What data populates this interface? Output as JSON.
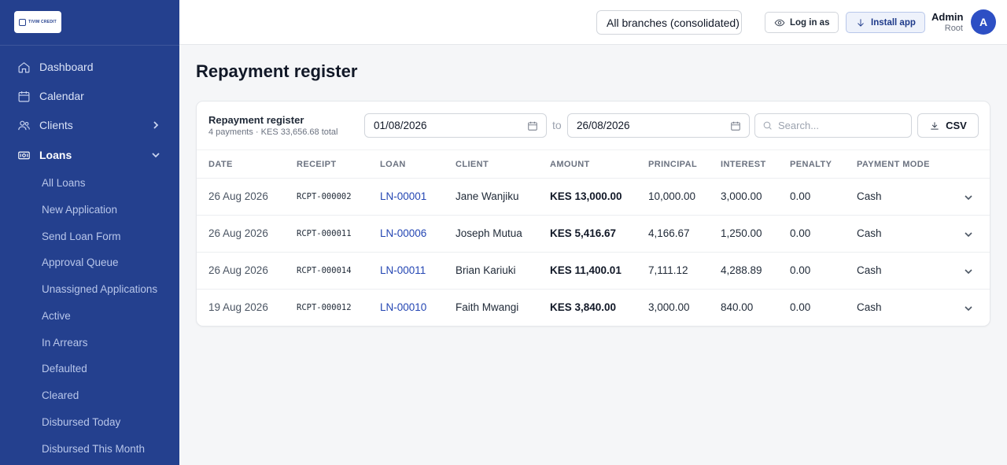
{
  "app": {
    "logo_text": "TIVIM CREDIT"
  },
  "sidebar": {
    "items": [
      {
        "label": "Dashboard",
        "icon": "home-icon"
      },
      {
        "label": "Calendar",
        "icon": "calendar-icon"
      },
      {
        "label": "Clients",
        "icon": "users-icon"
      },
      {
        "label": "Loans",
        "icon": "loans-icon"
      }
    ],
    "loans_sub": [
      "All Loans",
      "New Application",
      "Send Loan Form",
      "Approval Queue",
      "Unassigned Applications",
      "Active",
      "In Arrears",
      "Defaulted",
      "Cleared",
      "Disbursed Today",
      "Disbursed This Month"
    ]
  },
  "topbar": {
    "branch": "All branches (consolidated)",
    "login_as": "Log in as",
    "install": "Install app",
    "user_name": "Admin",
    "user_role": "Root",
    "avatar_initial": "A"
  },
  "page": {
    "title": "Repayment register"
  },
  "register": {
    "title": "Repayment register",
    "subtitle": "4 payments · KES 33,656.68 total",
    "date_from": "01/08/2026",
    "to_label": "to",
    "date_to": "26/08/2026",
    "search_placeholder": "Search...",
    "csv_label": "CSV",
    "columns": [
      "DATE",
      "RECEIPT",
      "LOAN",
      "CLIENT",
      "AMOUNT",
      "PRINCIPAL",
      "INTEREST",
      "PENALTY",
      "PAYMENT MODE"
    ],
    "rows": [
      {
        "date": "26 Aug 2026",
        "receipt": "RCPT-000002",
        "loan": "LN-00001",
        "client": "Jane Wanjiku",
        "amount": "KES 13,000.00",
        "principal": "10,000.00",
        "interest": "3,000.00",
        "penalty": "0.00",
        "mode": "Cash"
      },
      {
        "date": "26 Aug 2026",
        "receipt": "RCPT-000011",
        "loan": "LN-00006",
        "client": "Joseph Mutua",
        "amount": "KES 5,416.67",
        "principal": "4,166.67",
        "interest": "1,250.00",
        "penalty": "0.00",
        "mode": "Cash"
      },
      {
        "date": "26 Aug 2026",
        "receipt": "RCPT-000014",
        "loan": "LN-00011",
        "client": "Brian Kariuki",
        "amount": "KES 11,400.01",
        "principal": "7,111.12",
        "interest": "4,288.89",
        "penalty": "0.00",
        "mode": "Cash"
      },
      {
        "date": "19 Aug 2026",
        "receipt": "RCPT-000012",
        "loan": "LN-00010",
        "client": "Faith Mwangi",
        "amount": "KES 3,840.00",
        "principal": "3,000.00",
        "interest": "840.00",
        "penalty": "0.00",
        "mode": "Cash"
      }
    ]
  }
}
